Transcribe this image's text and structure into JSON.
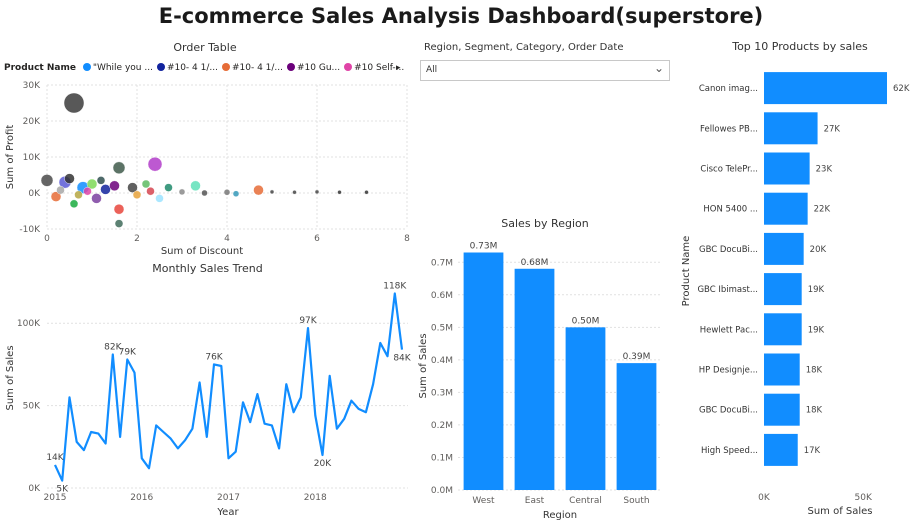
{
  "dashboard": {
    "title": "E-commerce Sales Analysis Dashboard(superstore)"
  },
  "slicer": {
    "label": "Region, Segment, Category, Order Date",
    "value": "All",
    "chevron": "chevron-down-icon"
  },
  "order_table": {
    "title": "Order Table",
    "legend_title": "Product Name",
    "legend_items": [
      {
        "label": "\"While you ...",
        "color": "#118DFF"
      },
      {
        "label": "#10- 4 1/...",
        "color": "#12239E"
      },
      {
        "label": "#10- 4 1/...",
        "color": "#E66C37"
      },
      {
        "label": "#10 Gu...",
        "color": "#6B007B"
      },
      {
        "label": "#10 Self-...",
        "color": "#E044A7"
      }
    ],
    "legend_more": "▸"
  },
  "chart_data": [
    {
      "id": "order_table",
      "type": "scatter",
      "title": "Order Table",
      "xlabel": "Sum of Discount",
      "ylabel": "Sum of Profit",
      "xlim": [
        0,
        8
      ],
      "ylim": [
        -10000,
        30000
      ],
      "xticks": [
        "0",
        "2",
        "4",
        "6",
        "8"
      ],
      "yticks": [
        "-10K",
        "0K",
        "10K",
        "20K",
        "30K"
      ],
      "points": [
        {
          "x": 0.6,
          "y": 25000,
          "r": 10,
          "c": "#3b3b3b"
        },
        {
          "x": 1.6,
          "y": 7000,
          "r": 6,
          "c": "#3f5a4b"
        },
        {
          "x": 2.4,
          "y": 8000,
          "r": 7,
          "c": "#B23CC9"
        },
        {
          "x": 1.6,
          "y": -4500,
          "r": 5,
          "c": "#E8453C"
        },
        {
          "x": 1.6,
          "y": -8500,
          "r": 4,
          "c": "#3f6b5a"
        },
        {
          "x": 0.0,
          "y": 3500,
          "r": 6,
          "c": "#4a4a4a"
        },
        {
          "x": 0.4,
          "y": 3000,
          "r": 6,
          "c": "#5a5ad6"
        },
        {
          "x": 0.5,
          "y": 4000,
          "r": 5,
          "c": "#333333"
        },
        {
          "x": 0.8,
          "y": 1500,
          "r": 6,
          "c": "#118DFF"
        },
        {
          "x": 1.0,
          "y": 2500,
          "r": 5,
          "c": "#7ED957"
        },
        {
          "x": 1.3,
          "y": 1000,
          "r": 5,
          "c": "#12239E"
        },
        {
          "x": 0.2,
          "y": -1000,
          "r": 5,
          "c": "#E66C37"
        },
        {
          "x": 0.6,
          "y": -3000,
          "r": 4,
          "c": "#1AAB40"
        },
        {
          "x": 1.1,
          "y": -1500,
          "r": 5,
          "c": "#7B3FA0"
        },
        {
          "x": 0.9,
          "y": 500,
          "r": 4,
          "c": "#E044A7"
        },
        {
          "x": 1.5,
          "y": 2000,
          "r": 5,
          "c": "#6B007B"
        },
        {
          "x": 1.9,
          "y": 1500,
          "r": 5,
          "c": "#444444"
        },
        {
          "x": 2.3,
          "y": 500,
          "r": 4,
          "c": "#D64550"
        },
        {
          "x": 2.5,
          "y": -1500,
          "r": 4,
          "c": "#9BE3FF"
        },
        {
          "x": 2.7,
          "y": 1500,
          "r": 4,
          "c": "#1E8A6B"
        },
        {
          "x": 3.3,
          "y": 2000,
          "r": 5,
          "c": "#5FE0B8"
        },
        {
          "x": 3.0,
          "y": 300,
          "r": 3,
          "c": "#8A8A8A"
        },
        {
          "x": 3.5,
          "y": 0,
          "r": 3,
          "c": "#555555"
        },
        {
          "x": 4.0,
          "y": 200,
          "r": 3,
          "c": "#777777"
        },
        {
          "x": 4.2,
          "y": -200,
          "r": 3,
          "c": "#3599B8"
        },
        {
          "x": 4.7,
          "y": 800,
          "r": 5,
          "c": "#E66C37"
        },
        {
          "x": 5.0,
          "y": 300,
          "r": 2,
          "c": "#444444"
        },
        {
          "x": 5.5,
          "y": 200,
          "r": 2,
          "c": "#444444"
        },
        {
          "x": 6.0,
          "y": 300,
          "r": 2,
          "c": "#444444"
        },
        {
          "x": 6.5,
          "y": 200,
          "r": 2,
          "c": "#333333"
        },
        {
          "x": 7.1,
          "y": 200,
          "r": 2,
          "c": "#333333"
        },
        {
          "x": 0.3,
          "y": 800,
          "r": 4,
          "c": "#A7A7A7"
        },
        {
          "x": 0.7,
          "y": -500,
          "r": 4,
          "c": "#B5A642"
        },
        {
          "x": 1.2,
          "y": 3500,
          "r": 4,
          "c": "#2F4F4F"
        },
        {
          "x": 2.0,
          "y": -500,
          "r": 4,
          "c": "#E8A33C"
        },
        {
          "x": 2.2,
          "y": 2500,
          "r": 4,
          "c": "#5DBB63"
        }
      ]
    },
    {
      "id": "monthly_trend",
      "type": "line",
      "title": "Monthly Sales Trend",
      "xlabel": "Year",
      "ylabel": "Sum of Sales",
      "xlim": [
        2015,
        2019
      ],
      "ylim": [
        0,
        125000
      ],
      "xticks": [
        2015,
        2016,
        2017,
        2018
      ],
      "yticks": [
        0,
        50000,
        100000
      ],
      "ytick_labels": [
        "0K",
        "50K",
        "100K"
      ],
      "color": "#118DFF",
      "values": [
        14000,
        4500,
        55000,
        28000,
        23000,
        34000,
        33000,
        27000,
        81000,
        31000,
        78000,
        70000,
        18000,
        12000,
        38000,
        34000,
        30000,
        24000,
        29000,
        36000,
        64000,
        31000,
        75000,
        74000,
        18000,
        22000,
        52000,
        40000,
        57000,
        39000,
        38000,
        24000,
        63000,
        46000,
        55000,
        97000,
        44000,
        20000,
        68000,
        36000,
        42000,
        53000,
        48000,
        46000,
        63000,
        88000,
        80000,
        118000,
        84000
      ],
      "data_labels": [
        {
          "i": 0,
          "text": "14K"
        },
        {
          "i": 1,
          "text": "5K"
        },
        {
          "i": 8,
          "text": "82K"
        },
        {
          "i": 10,
          "text": "79K"
        },
        {
          "i": 22,
          "text": "76K"
        },
        {
          "i": 35,
          "text": "97K"
        },
        {
          "i": 37,
          "text": "20K"
        },
        {
          "i": 47,
          "text": "118K"
        },
        {
          "i": 48,
          "text": "84K"
        }
      ]
    },
    {
      "id": "sales_by_region",
      "type": "bar",
      "title": "Sales by Region",
      "xlabel": "Region",
      "ylabel": "Sum of Sales",
      "categories": [
        "West",
        "East",
        "Central",
        "South"
      ],
      "values": [
        0.73,
        0.68,
        0.5,
        0.39
      ],
      "value_labels": [
        "0.73M",
        "0.68M",
        "0.50M",
        "0.39M"
      ],
      "ylim": [
        0,
        0.75
      ],
      "yticks": [
        "0.0M",
        "0.1M",
        "0.2M",
        "0.3M",
        "0.4M",
        "0.5M",
        "0.6M",
        "0.7M"
      ],
      "color": "#118DFF"
    },
    {
      "id": "top10_products",
      "type": "bar",
      "orientation": "horizontal",
      "title": "Top 10 Products by sales",
      "xlabel": "Sum of Sales",
      "ylabel": "Product Name",
      "categories": [
        "Canon imag...",
        "Fellowes PB...",
        "Cisco TelePr...",
        "HON 5400 ...",
        "GBC DocuBi...",
        "GBC Ibimast...",
        "Hewlett Pac...",
        "HP Designje...",
        "GBC DocuBi...",
        "High Speed..."
      ],
      "values": [
        62000,
        27000,
        23000,
        22000,
        20000,
        19000,
        19000,
        18000,
        18000,
        17000
      ],
      "value_labels": [
        "62K",
        "27K",
        "23K",
        "22K",
        "20K",
        "19K",
        "19K",
        "18K",
        "18K",
        "17K"
      ],
      "xlim": [
        0,
        62000
      ],
      "xticks": [
        "0K",
        "50K"
      ],
      "color": "#118DFF"
    }
  ]
}
